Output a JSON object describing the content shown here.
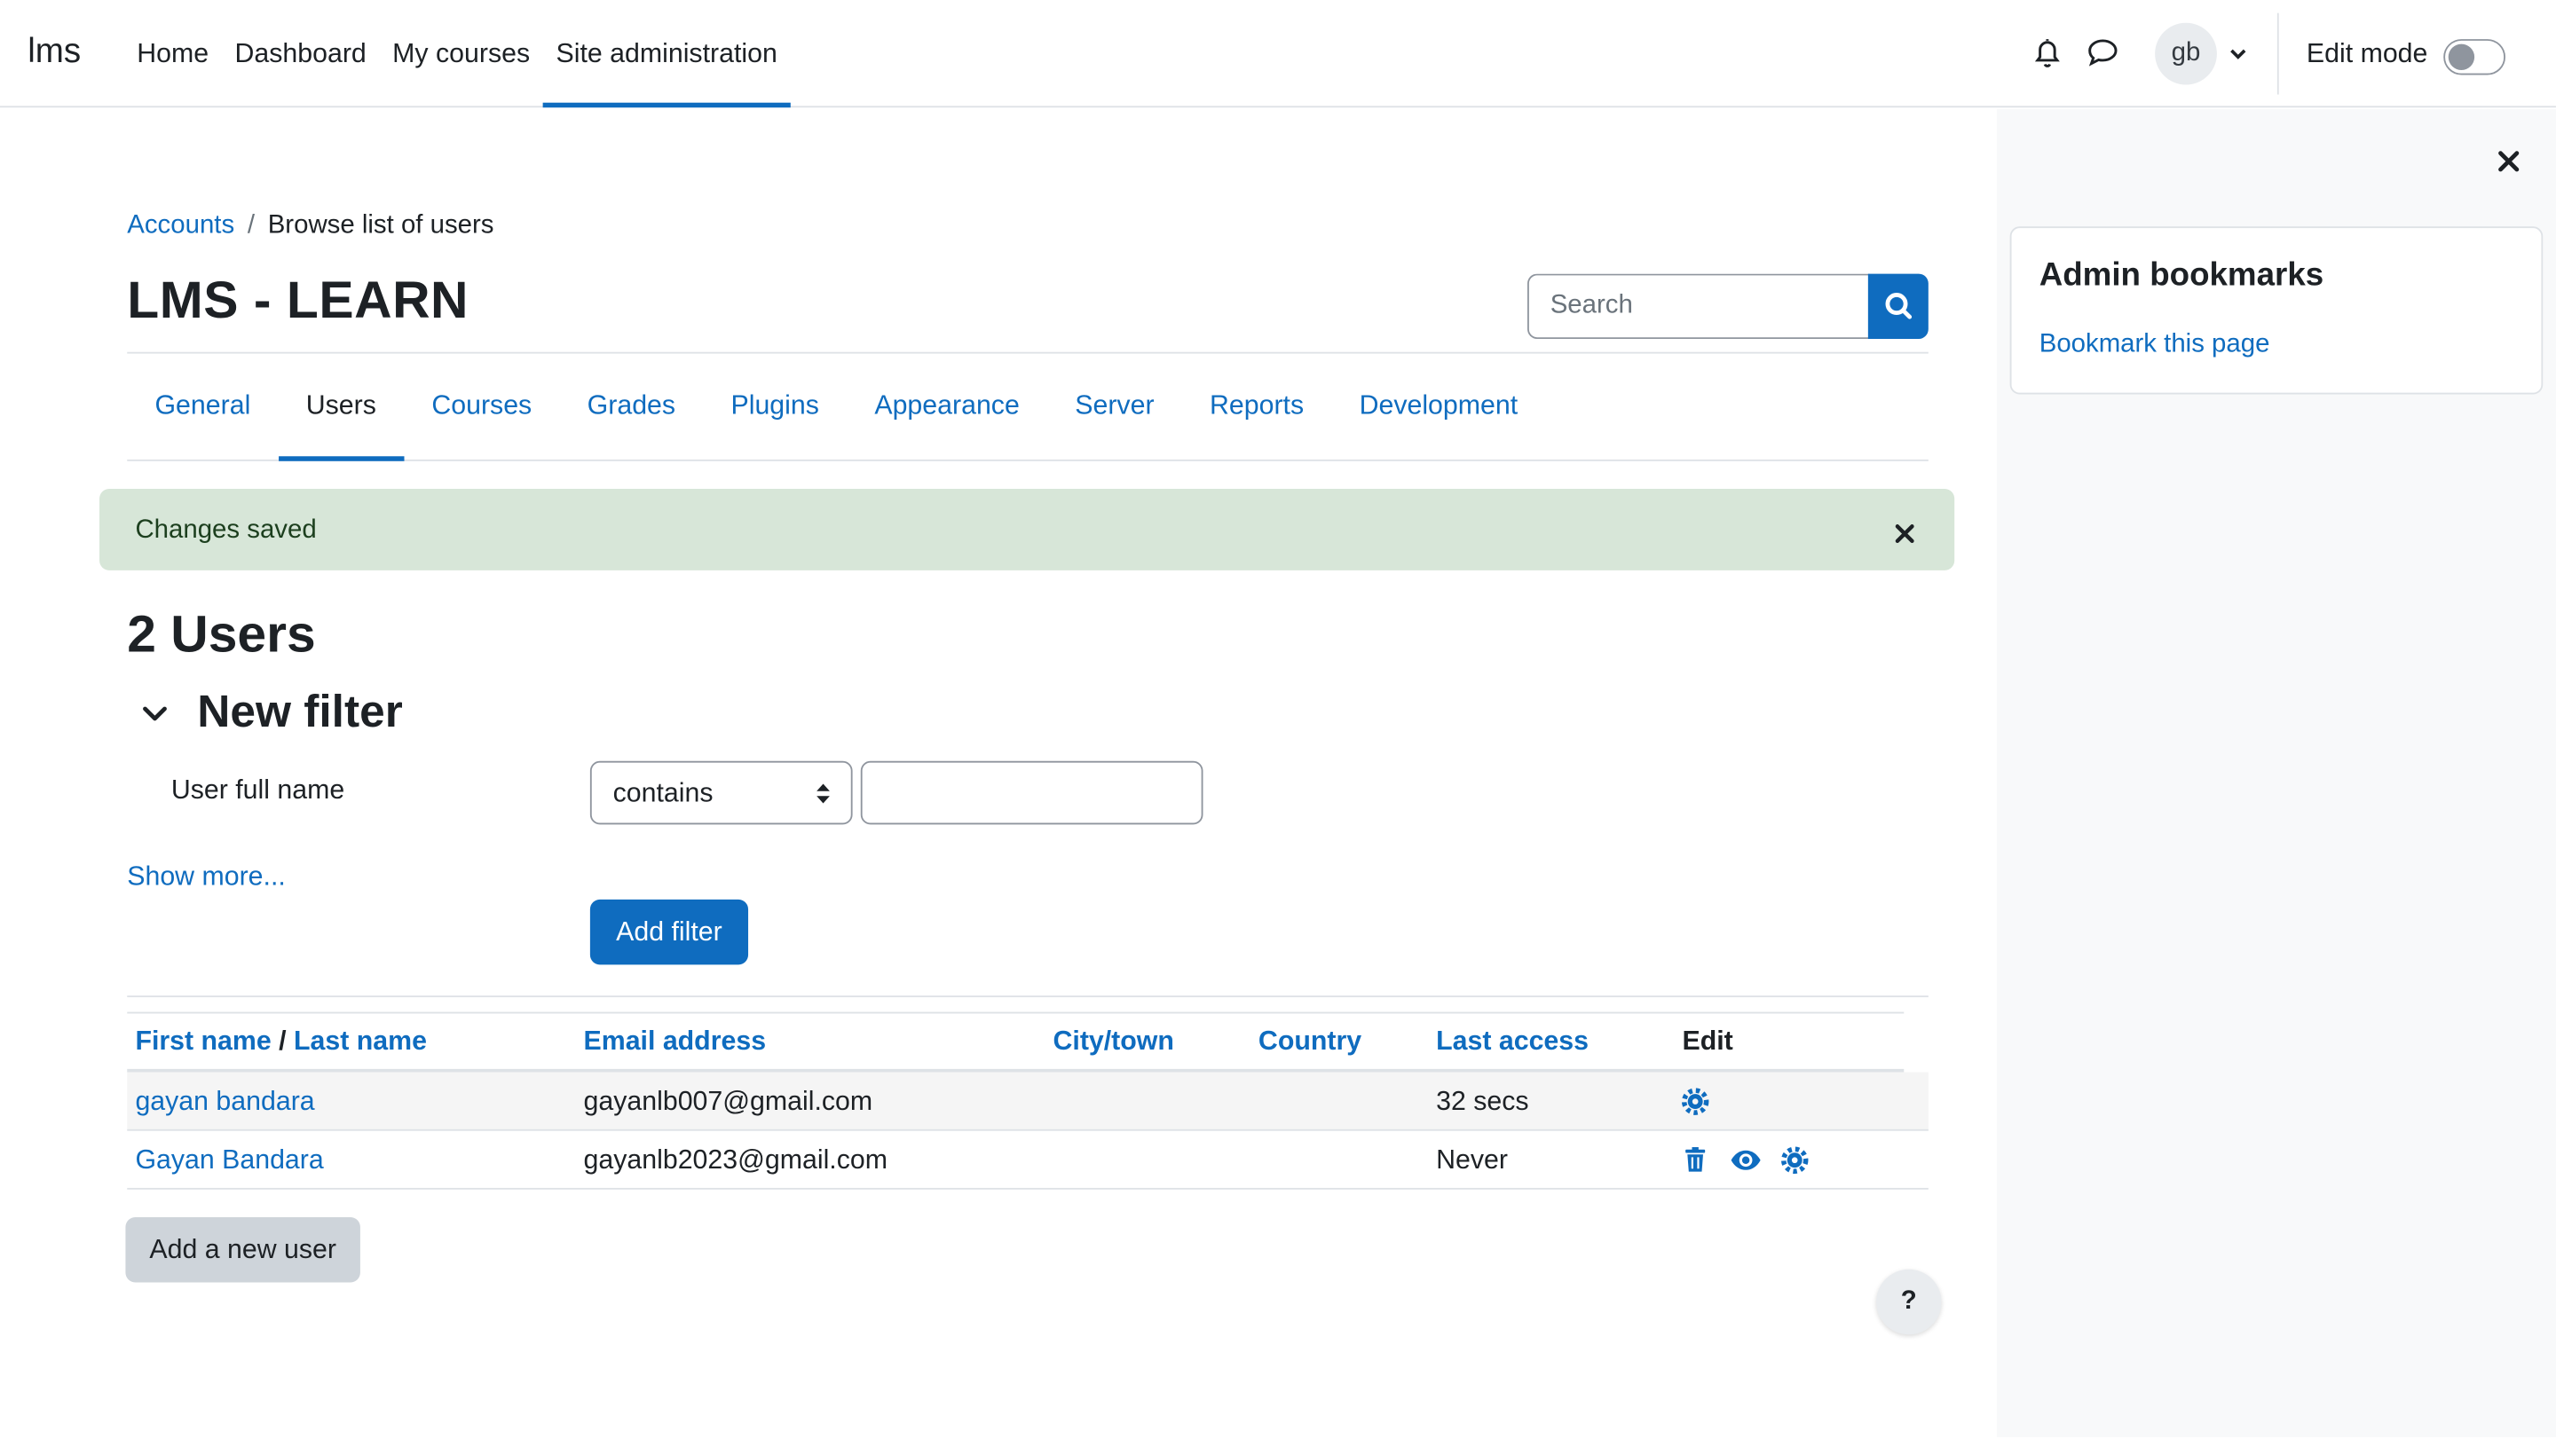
{
  "brand": "lms",
  "primary_nav": [
    {
      "label": "Home",
      "active": false
    },
    {
      "label": "Dashboard",
      "active": false
    },
    {
      "label": "My courses",
      "active": false
    },
    {
      "label": "Site administration",
      "active": true
    }
  ],
  "user": {
    "initials": "gb"
  },
  "edit_mode": {
    "label": "Edit mode",
    "enabled": false
  },
  "drawer": {
    "title": "Admin bookmarks",
    "link": "Bookmark this page"
  },
  "breadcrumb": {
    "parent": "Accounts",
    "separator": "/",
    "current": "Browse list of users"
  },
  "page_title": "LMS - LEARN",
  "search": {
    "placeholder": "Search"
  },
  "secondary_tabs": [
    {
      "label": "General",
      "active": false
    },
    {
      "label": "Users",
      "active": true
    },
    {
      "label": "Courses",
      "active": false
    },
    {
      "label": "Grades",
      "active": false
    },
    {
      "label": "Plugins",
      "active": false
    },
    {
      "label": "Appearance",
      "active": false
    },
    {
      "label": "Server",
      "active": false
    },
    {
      "label": "Reports",
      "active": false
    },
    {
      "label": "Development",
      "active": false
    }
  ],
  "alert": {
    "message": "Changes saved"
  },
  "users_heading": "2 Users",
  "filter": {
    "heading": "New filter",
    "field_label": "User full name",
    "operator": "contains",
    "value": "",
    "show_more": "Show more...",
    "add_button": "Add filter"
  },
  "table": {
    "headers": {
      "first_name": "First name",
      "slash": "/",
      "last_name": "Last name",
      "email": "Email address",
      "city": "City/town",
      "country": "Country",
      "last_access": "Last access",
      "edit": "Edit"
    },
    "rows": [
      {
        "name": "gayan bandara",
        "email": "gayanlb007@gmail.com",
        "city": "",
        "country": "",
        "last_access": "32 secs",
        "actions": [
          "settings-icon"
        ]
      },
      {
        "name": "Gayan Bandara",
        "email": "gayanlb2023@gmail.com",
        "city": "",
        "country": "",
        "last_access": "Never",
        "actions": [
          "trash-icon",
          "eye-icon",
          "settings-icon"
        ]
      }
    ]
  },
  "add_user_button": "Add a new user",
  "help_button": "?",
  "colors": {
    "primary": "#0f6cbf",
    "success_bg": "#d7e6d8",
    "drawer_bg": "#f8f9fa"
  }
}
